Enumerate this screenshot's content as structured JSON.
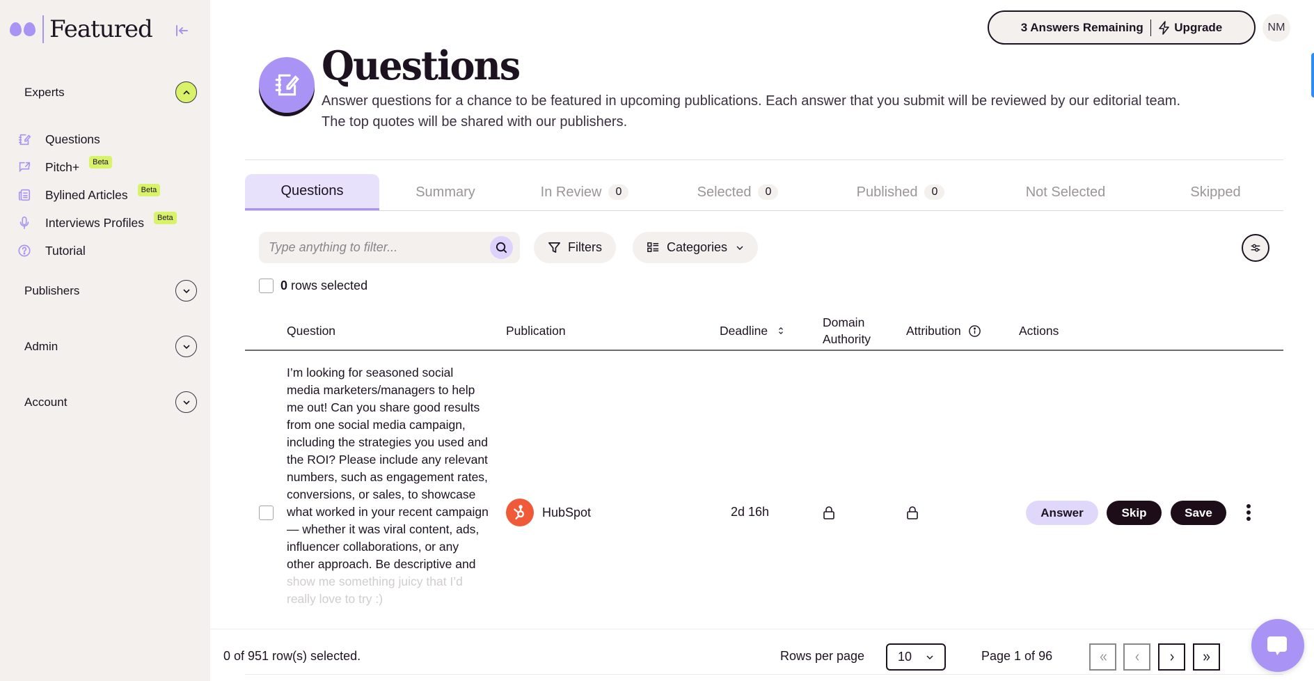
{
  "sidebar": {
    "brand": "Featured",
    "sections": [
      {
        "label": "Experts",
        "expanded": true
      },
      {
        "label": "Publishers",
        "expanded": false
      },
      {
        "label": "Admin",
        "expanded": false
      },
      {
        "label": "Account",
        "expanded": false
      }
    ],
    "nav_items": [
      {
        "label": "Questions",
        "icon": "notebook-edit-icon",
        "badge": null
      },
      {
        "label": "Pitch+",
        "icon": "chat-external-icon",
        "badge": "Beta"
      },
      {
        "label": "Bylined Articles",
        "icon": "newspaper-icon",
        "badge": "Beta"
      },
      {
        "label": "Interviews Profiles",
        "icon": "microphone-icon",
        "badge": "Beta"
      },
      {
        "label": "Tutorial",
        "icon": "help-circle-icon",
        "badge": null
      }
    ]
  },
  "topbar": {
    "answers_remaining": "3 Answers Remaining",
    "upgrade_label": "Upgrade",
    "avatar_initials": "NM"
  },
  "header": {
    "title": "Questions",
    "description": "Answer questions for a chance to be featured in upcoming publications. Each answer that you submit will be reviewed by our editorial team. The top quotes will be shared with our publishers."
  },
  "tabs": [
    {
      "label": "Questions",
      "count": null,
      "active": true
    },
    {
      "label": "Summary",
      "count": null,
      "active": false
    },
    {
      "label": "In Review",
      "count": "0",
      "active": false
    },
    {
      "label": "Selected",
      "count": "0",
      "active": false
    },
    {
      "label": "Published",
      "count": "0",
      "active": false
    },
    {
      "label": "Not Selected",
      "count": null,
      "active": false
    },
    {
      "label": "Skipped",
      "count": null,
      "active": false
    }
  ],
  "toolbar": {
    "search_placeholder": "Type anything to filter...",
    "filters_label": "Filters",
    "categories_label": "Categories",
    "rows_selected_count": "0",
    "rows_selected_text": "rows selected"
  },
  "table": {
    "columns": {
      "question": "Question",
      "publication": "Publication",
      "deadline": "Deadline",
      "domain_authority_1": "Domain",
      "domain_authority_2": "Authority",
      "attribution": "Attribution",
      "actions": "Actions"
    },
    "rows": [
      {
        "question": "I’m looking for seasoned social media marketers/managers to help me out! Can you share good results from one social media campaign, including the strategies you used and the ROI? Please include any relevant numbers, such as engagement rates, conversions, or sales, to showcase what worked in your recent campaign — whether it was viral content, ads, influencer collaborations, or any other approach. Be descriptive and",
        "question_faded": "show me something juicy that I’d really love to try :)",
        "publication": "HubSpot",
        "deadline": "2d 16h",
        "domain_authority": "locked",
        "attribution": "locked",
        "actions": {
          "answer": "Answer",
          "skip": "Skip",
          "save": "Save"
        }
      }
    ]
  },
  "footer": {
    "selection_text": "0 of 951 row(s) selected.",
    "rows_per_page_label": "Rows per page",
    "rows_per_page_value": "10",
    "page_text": "Page 1 of 96"
  },
  "colors": {
    "accent_purple": "#a993f5",
    "beta_lime": "#d8f36a",
    "dark": "#1c0d18",
    "hubspot_orange": "#f05a38"
  }
}
